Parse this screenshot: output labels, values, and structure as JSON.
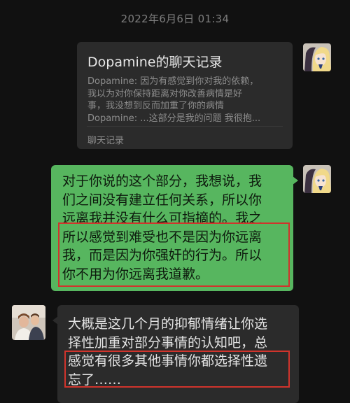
{
  "header": {
    "timestamp": "2022年6月6日 01:34"
  },
  "record_card": {
    "title": "Dopamine的聊天记录",
    "preview_lines": [
      "Dopamine: 因为有感觉到你对我的依赖，",
      "我以为对你保持距离对你改善病情是好",
      "事，我没想到反而加重了你的病情",
      "Dopamine: ...这部分是我的问题 我很抱..."
    ],
    "footer": "聊天记录"
  },
  "outgoing_message": {
    "lines": [
      "对于你说的这个部分，我想说，我",
      "们之间没有建立任何关系，所以你",
      "远离我并没有什么可指摘的。我之",
      "所以感觉到难受也不是因为你远离",
      "我，而是因为你强奸的行为。所以",
      "你不用为你远离我道歉。"
    ]
  },
  "incoming_message": {
    "lines": [
      "大概是这几个月的抑郁情绪让你选",
      "择性加重对部分事情的认知吧，总",
      "感觉有很多其他事情你都选择性遗",
      "忘了……"
    ]
  },
  "colors": {
    "background": "#111111",
    "bubble_green": "#57b65f",
    "bubble_gray": "#2b2b2b",
    "highlight": "#d0342c"
  },
  "icons": {
    "self_avatar": "anime-avatar-icon",
    "other_avatar": "photo-avatar-icon"
  }
}
